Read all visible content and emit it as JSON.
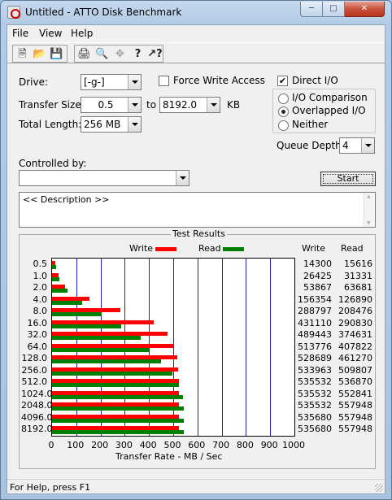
{
  "window": {
    "title": "Untitled - ATTO Disk Benchmark"
  },
  "menu": [
    "File",
    "View",
    "Help"
  ],
  "toolbar_icons": [
    "new-file-icon",
    "open-folder-icon",
    "save-icon",
    "print-icon",
    "print-preview-icon",
    "move-icon",
    "help-icon",
    "context-help-icon"
  ],
  "form": {
    "drive_label": "Drive:",
    "drive_value": "[-g-]",
    "force_write_label": "Force Write Access",
    "force_write_checked": false,
    "direct_io_label": "Direct I/O",
    "direct_io_checked": true,
    "transfer_size_label": "Transfer Size:",
    "transfer_from": "0.5",
    "to_label": "to",
    "transfer_to": "8192.0",
    "unit": "KB",
    "total_length_label": "Total Length:",
    "total_length": "256 MB",
    "io_comparison_label": "I/O Comparison",
    "overlapped_io_label": "Overlapped I/O",
    "neither_label": "Neither",
    "selected_mode": "Overlapped I/O",
    "queue_depth_label": "Queue Depth:",
    "queue_depth": "4",
    "controlled_by_label": "Controlled by:",
    "controlled_by_value": "",
    "start_label": "Start",
    "description": "<< Description >>"
  },
  "results": {
    "title": "Test Results",
    "write_legend": "Write",
    "read_legend": "Read",
    "write_header": "Write",
    "read_header": "Read",
    "x_axis_label": "Transfer Rate - MB / Sec",
    "colors": {
      "write": "#ff0000",
      "read": "#008000",
      "grid": "#1e1ec8"
    }
  },
  "chart_data": {
    "type": "bar",
    "orientation": "horizontal",
    "categories": [
      "0.5",
      "1.0",
      "2.0",
      "4.0",
      "8.0",
      "16.0",
      "32.0",
      "64.0",
      "128.0",
      "256.0",
      "512.0",
      "1024.0",
      "2048.0",
      "4096.0",
      "8192.0"
    ],
    "series": [
      {
        "name": "Write",
        "values": [
          14300,
          26425,
          53867,
          156354,
          288797,
          431110,
          489443,
          513776,
          528689,
          533963,
          535532,
          535532,
          535532,
          535680,
          535680
        ]
      },
      {
        "name": "Read",
        "values": [
          15616,
          31331,
          63681,
          126890,
          208476,
          290830,
          374631,
          407822,
          461270,
          509807,
          536870,
          552841,
          557948,
          557948,
          557948
        ]
      }
    ],
    "xlim": [
      0,
      1000
    ],
    "xticks": [
      "0",
      "100",
      "200",
      "300",
      "400",
      "500",
      "600",
      "700",
      "800",
      "900",
      "1000"
    ],
    "xlabel": "Transfer Rate - MB / Sec",
    "grid": true,
    "legend": "top"
  },
  "status": {
    "text": "For Help, press F1"
  }
}
